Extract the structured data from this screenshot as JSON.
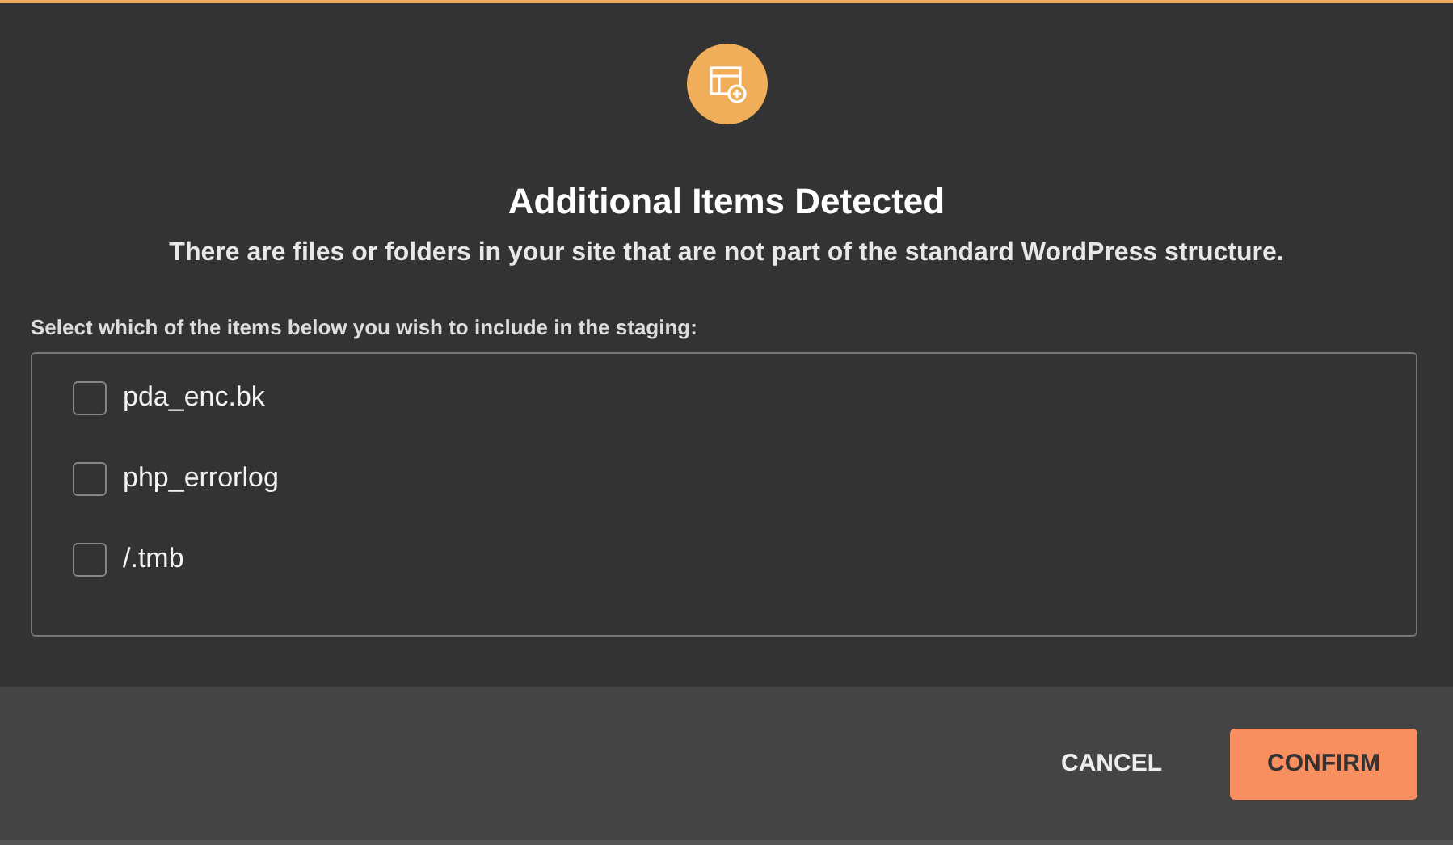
{
  "dialog": {
    "title": "Additional Items Detected",
    "subtitle": "There are files or folders in your site that are not part of the standard WordPress structure.",
    "prompt": "Select which of the items below you wish to include in the staging:",
    "items": [
      {
        "label": "pda_enc.bk",
        "checked": false
      },
      {
        "label": "php_errorlog",
        "checked": false
      },
      {
        "label": "/.tmb",
        "checked": false
      }
    ],
    "buttons": [
      {
        "label": "CANCEL",
        "kind": "text"
      },
      {
        "label": "CONFIRM",
        "kind": "primary"
      }
    ]
  }
}
